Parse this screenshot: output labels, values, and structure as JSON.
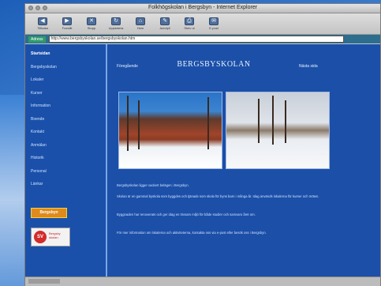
{
  "window": {
    "title": "Folkhögskolan i Bergsbyn - Internet Explorer"
  },
  "toolbar": {
    "buttons": [
      {
        "label": "Tillbaka",
        "icon": "back-arrow-icon",
        "glyph": "◀"
      },
      {
        "label": "Framåt",
        "icon": "forward-arrow-icon",
        "glyph": "▶"
      },
      {
        "label": "Stopp",
        "icon": "stop-icon",
        "glyph": "✕"
      },
      {
        "label": "Uppdatera",
        "icon": "refresh-icon",
        "glyph": "↻"
      },
      {
        "label": "Hem",
        "icon": "home-icon",
        "glyph": "⌂"
      },
      {
        "label": "Autofyll",
        "icon": "autofill-icon",
        "glyph": "✎"
      },
      {
        "label": "Skriv ut",
        "icon": "print-icon",
        "glyph": "⎙"
      },
      {
        "label": "E-post",
        "icon": "mail-icon",
        "glyph": "✉"
      }
    ]
  },
  "address": {
    "label": "Adress",
    "url": "http://www.bergsbyskolan.se/bergsbyskolan.htm"
  },
  "sidebar": {
    "items": [
      {
        "label": "Startsidan",
        "current": true
      },
      {
        "label": "Bergsbyskolan"
      },
      {
        "label": "Lokaler"
      },
      {
        "label": "Kurser"
      },
      {
        "label": "Information"
      },
      {
        "label": "Boende"
      },
      {
        "label": "Kontakt"
      },
      {
        "label": "Anmälan"
      },
      {
        "label": "Historik"
      },
      {
        "label": "Personal"
      },
      {
        "label": "Länkar"
      }
    ],
    "badge1": "Bergsbyn",
    "badge2_circle": "SV",
    "badge2_text": "Bergsby skolan"
  },
  "main": {
    "prev": "Föregående",
    "title": "BERGSBYSKOLAN",
    "next": "Nästa sida",
    "paragraphs": [
      "Bergsbyskolan ligger vackert belägen i Bergsbyn.",
      "Skolan är en gammal byskola som byggdes och tjänade som skola för byns barn i många år. Idag används lokalerna för kurser och möten.",
      "Byggnaden har renoverats och ger idag en trivsam miljö för både studier och samvaro året om.",
      "För mer information om lokalerna och aktiviteterna, kontakta oss via e-post eller besök oss i Bergsbyn."
    ]
  },
  "colors": {
    "page_bg": "#1b4fa8",
    "sidebar_border": "#7aa6e6"
  }
}
